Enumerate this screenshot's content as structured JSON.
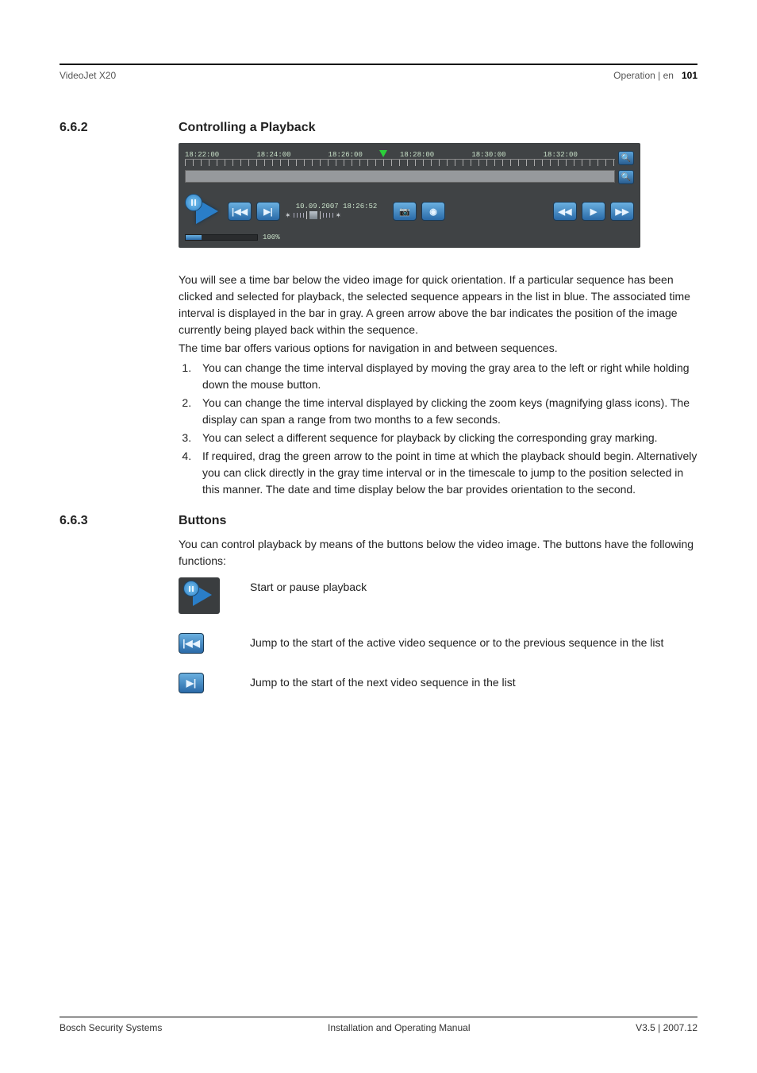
{
  "header": {
    "left": "VideoJet X20",
    "right_prefix": "Operation | en",
    "page_number": "101"
  },
  "section_662": {
    "number": "6.6.2",
    "title": "Controlling a Playback",
    "timeline_labels": [
      "18:22:00",
      "18:24:00",
      "18:26:00",
      "18:28:00",
      "18:30:00",
      "18:32:00"
    ],
    "datetime_label": "10.09.2007 18:26:52",
    "volume_label": "100%",
    "para1": "You will see a time bar below the video image for quick orientation. If a particular sequence has been clicked and selected for playback, the selected sequence appears in the list in blue. The associated time interval is displayed in the bar in gray. A green arrow above the bar indicates the position of the image currently being played back within the sequence.",
    "para2": "The time bar offers various options for navigation in and between sequences.",
    "steps": [
      "You can change the time interval displayed by moving the gray area to the left or right while holding down the mouse button.",
      "You can change the time interval displayed by clicking the zoom keys (magnifying glass icons). The display can span a range from two months to a few seconds.",
      "You can select a different sequence for playback by clicking the corresponding gray marking.",
      "If required, drag the green arrow to the point in time at which the playback should begin. Alternatively you can click directly in the gray time interval or in the timescale to jump to the position selected in this manner. The date and time display below the bar provides orientation to the second."
    ]
  },
  "section_663": {
    "number": "6.6.3",
    "title": "Buttons",
    "intro": "You can control playback by means of the buttons below the video image. The buttons have the following functions:",
    "rows": [
      {
        "desc": "Start or pause playback"
      },
      {
        "desc": "Jump to the start of the active video sequence or to the previous sequence in the list"
      },
      {
        "desc": "Jump to the start of the next video sequence in the list"
      }
    ]
  },
  "footer": {
    "left": "Bosch Security Systems",
    "center": "Installation and Operating Manual",
    "right": "V3.5 | 2007.12"
  }
}
